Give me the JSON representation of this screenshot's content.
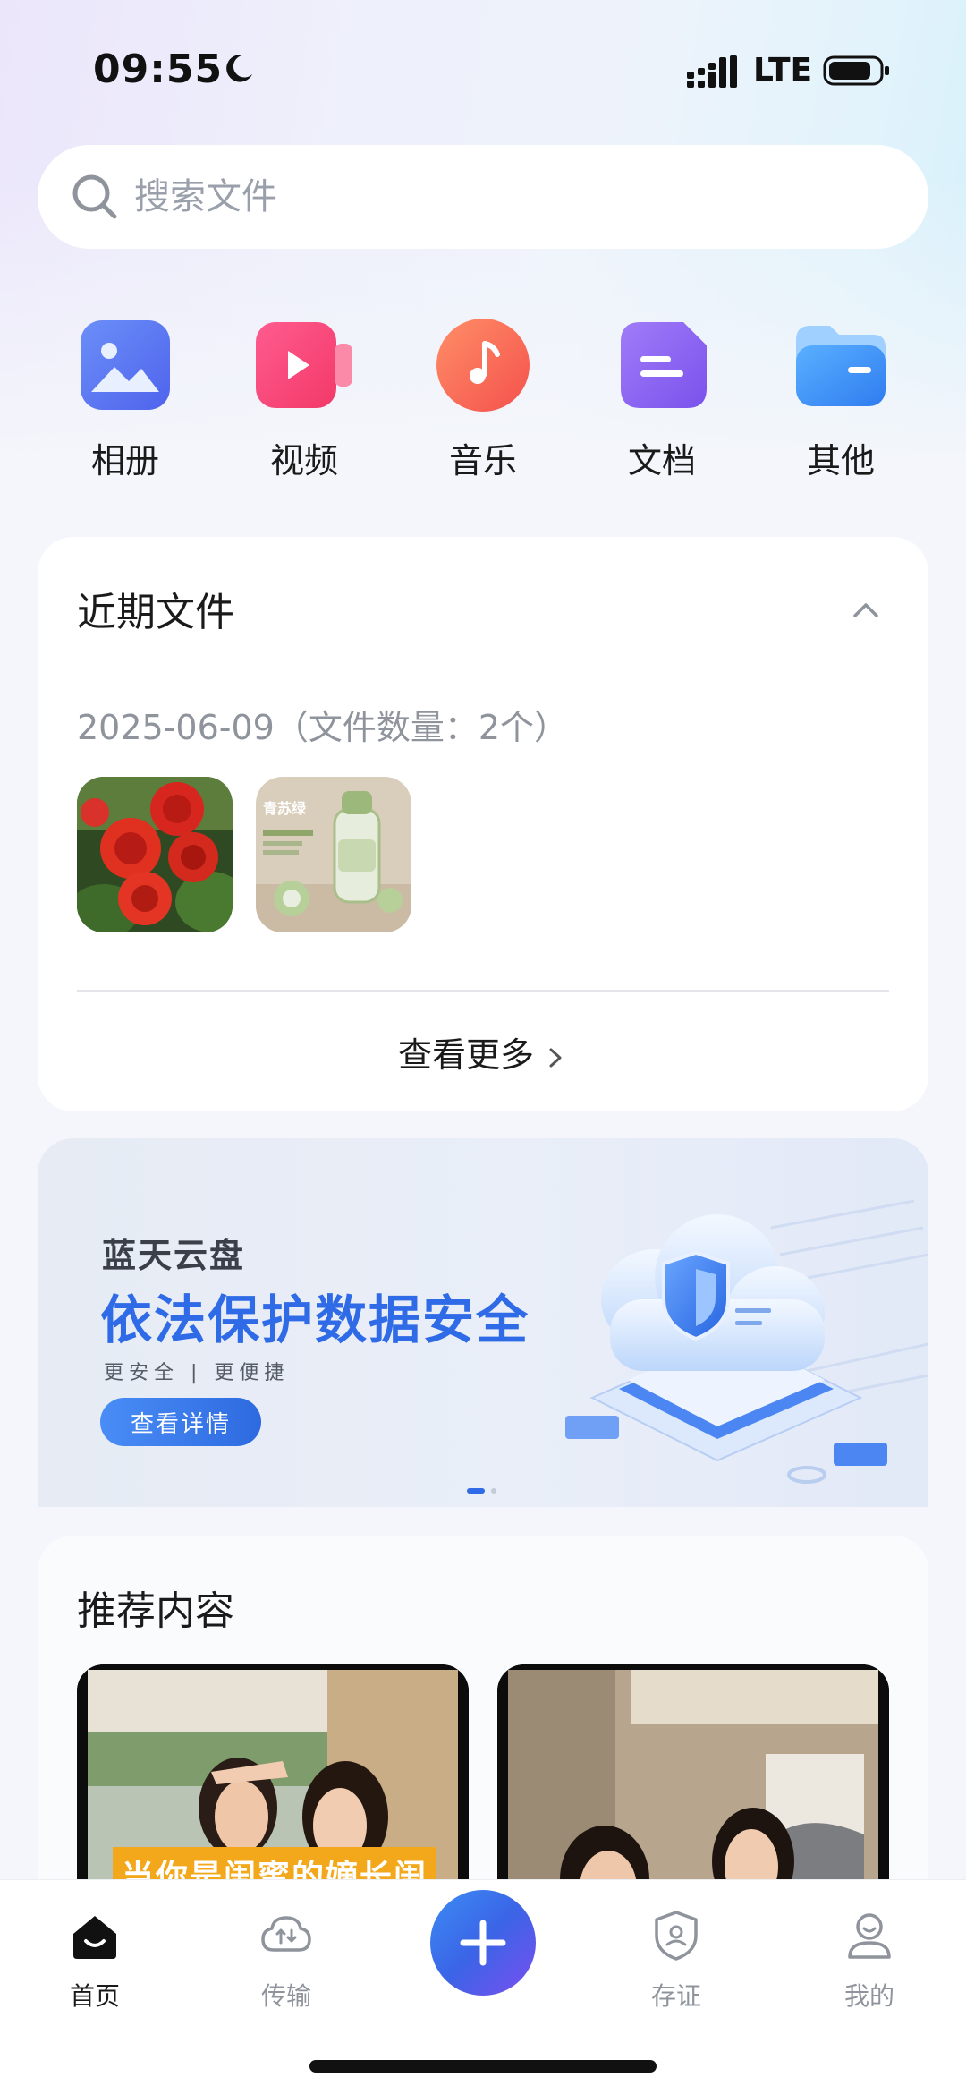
{
  "status_bar": {
    "time": "09:55",
    "network": "LTE"
  },
  "search": {
    "placeholder": "搜索文件"
  },
  "categories": [
    {
      "label": "相册",
      "icon": "album-icon",
      "color": "#5b7cf3"
    },
    {
      "label": "视频",
      "icon": "video-icon",
      "color": "#f5477a"
    },
    {
      "label": "音乐",
      "icon": "music-icon",
      "color": "#f86d55"
    },
    {
      "label": "文档",
      "icon": "document-icon",
      "color": "#8b63f2"
    },
    {
      "label": "其他",
      "icon": "folder-icon",
      "color": "#3a8df5"
    }
  ],
  "recent": {
    "title": "近期文件",
    "date_line": "2025-06-09（文件数量：2个）",
    "thumbnails": [
      {
        "icon": "rose-photo"
      },
      {
        "icon": "water-bottle-photo",
        "text": "青苏绿"
      }
    ],
    "see_more": "查看更多"
  },
  "banner": {
    "brand": "蓝天云盘",
    "title": "依法保护数据安全",
    "subtitle": "更安全 | 更便捷",
    "button": "查看详情",
    "accent": "#2f6be6"
  },
  "recommend": {
    "title": "推荐内容",
    "videos": [
      {
        "caption": "当你是闺蜜的嫡长闺"
      },
      {
        "caption": ""
      }
    ]
  },
  "tabbar": {
    "items": [
      {
        "label": "首页",
        "icon": "home-icon",
        "active": true
      },
      {
        "label": "传输",
        "icon": "transfer-cloud-icon",
        "active": false
      },
      {
        "label": "存证",
        "icon": "evidence-shield-icon",
        "active": false
      },
      {
        "label": "我的",
        "icon": "profile-icon",
        "active": false
      }
    ],
    "fab_icon": "plus-icon"
  }
}
